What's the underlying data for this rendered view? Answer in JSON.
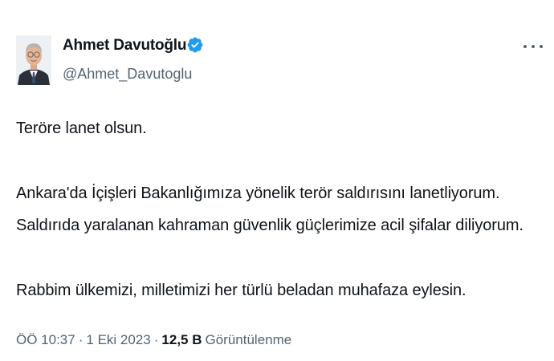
{
  "tweet": {
    "author": {
      "name": "Ahmet Davutoğlu",
      "handle": "@Ahmet_Davutoglu",
      "verified": true
    },
    "body": {
      "line1": "Teröre lanet olsun.",
      "line2": "Ankara'da İçişleri Bakanlığımıza yönelik terör saldırısını lanetliyorum.",
      "line3": "Saldırıda yaralanan kahraman güvenlik güçlerimize acil şifalar diliyorum.",
      "line4": "Rabbim ülkemizi, milletimizi her türlü beladan muhafaza eylesin."
    },
    "meta": {
      "time": "ÖÖ 10:37",
      "separator": "·",
      "date": "1 Eki 2023",
      "views_count": "12,5 B",
      "views_label": "Görüntülenme"
    }
  },
  "colors": {
    "text_primary": "#0f1419",
    "text_secondary": "#536471",
    "verified_blue": "#1d9bf0"
  },
  "icons": {
    "verified": "verified-badge-icon",
    "more": "more-options-icon"
  }
}
